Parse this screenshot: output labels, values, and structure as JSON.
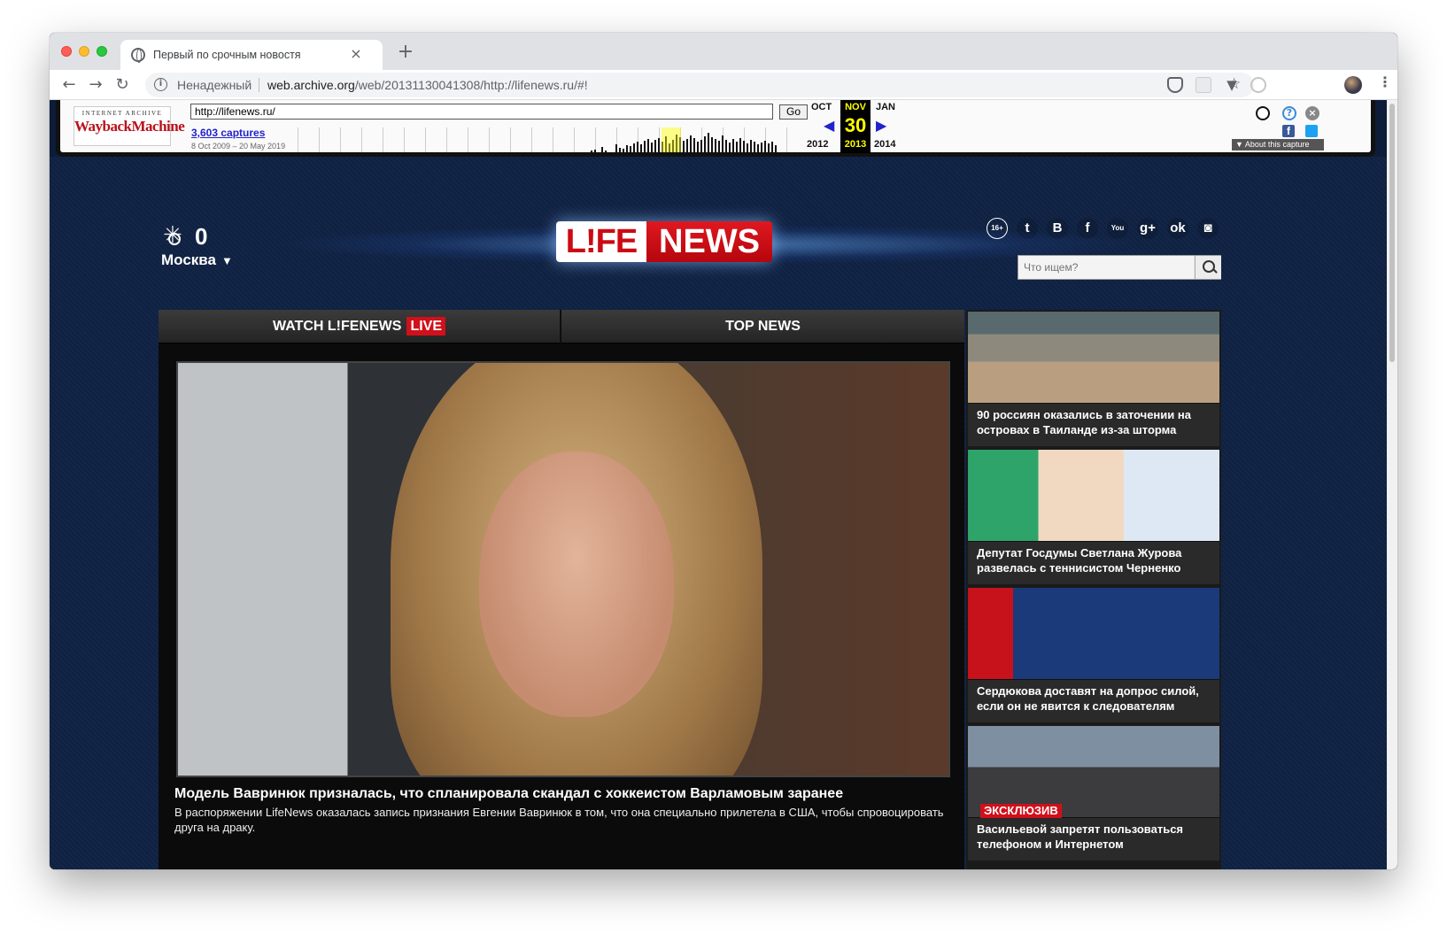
{
  "browser": {
    "tab_title": "Первый по срочным новостя",
    "close_tab": "×",
    "new_tab": "+",
    "back": "←",
    "forward": "→",
    "reload": "↻",
    "security_label": "Ненадежный",
    "url_host": "web.archive.org",
    "url_path": "/web/20131130041308/http://lifenews.ru/#!",
    "bookmark_icon": "star-icon",
    "menu": "⋮"
  },
  "wayback": {
    "logo_top": "INTERNET ARCHIVE",
    "logo_main": "WaybackMachine",
    "url_value": "http://lifenews.ru/",
    "go": "Go",
    "captures": "3,603 captures",
    "range": "8 Oct 2009 – 20 May 2019",
    "prev_month": "OCT",
    "cur_month": "NOV",
    "next_month": "JAN",
    "day": "30",
    "prev_year": "2012",
    "cur_year": "2013",
    "next_year": "2014",
    "about": "▼ About this capture"
  },
  "site": {
    "weather": {
      "temp": "0",
      "city": "Москва",
      "city_arrow": "▼"
    },
    "logo_life": "L!FE",
    "logo_news": "NEWS",
    "age_rating": "16+",
    "social": [
      {
        "icon": "twitter-icon",
        "glyph": "t"
      },
      {
        "icon": "vkontakte-icon",
        "glyph": "B"
      },
      {
        "icon": "facebook-icon",
        "glyph": "f"
      },
      {
        "icon": "youtube-icon",
        "glyph": "You"
      },
      {
        "icon": "google-plus-icon",
        "glyph": "g+"
      },
      {
        "icon": "odnoklassniki-icon",
        "glyph": "ok"
      },
      {
        "icon": "instagram-icon",
        "glyph": "◙"
      }
    ],
    "search_placeholder": "Что ищем?",
    "tabs": {
      "watch": "WATCH L!FENEWS",
      "live": "LIVE",
      "top": "TOP NEWS"
    },
    "hero": {
      "headline": "Модель Вавринюк призналась, что спланировала скандал с хоккеистом Варламовым заранее",
      "lead": "В распоряжении LifeNews оказалась запись признания Евгении Вавринюк в том, что она специально прилетела в США, чтобы спровоцировать друга на драку."
    },
    "side_news": [
      {
        "title": "90 россиян оказались в заточении на островах в Таиланде из-за шторма"
      },
      {
        "title": "Депутат Госдумы Светлана Журова развелась с теннисистом Черненко"
      },
      {
        "title": "Сердюкова доставят на допрос силой, если он не явится к следователям"
      },
      {
        "title": "Васильевой запретят пользоваться телефоном и Интернетом",
        "badge": "ЭКСКЛЮЗИВ"
      }
    ]
  }
}
